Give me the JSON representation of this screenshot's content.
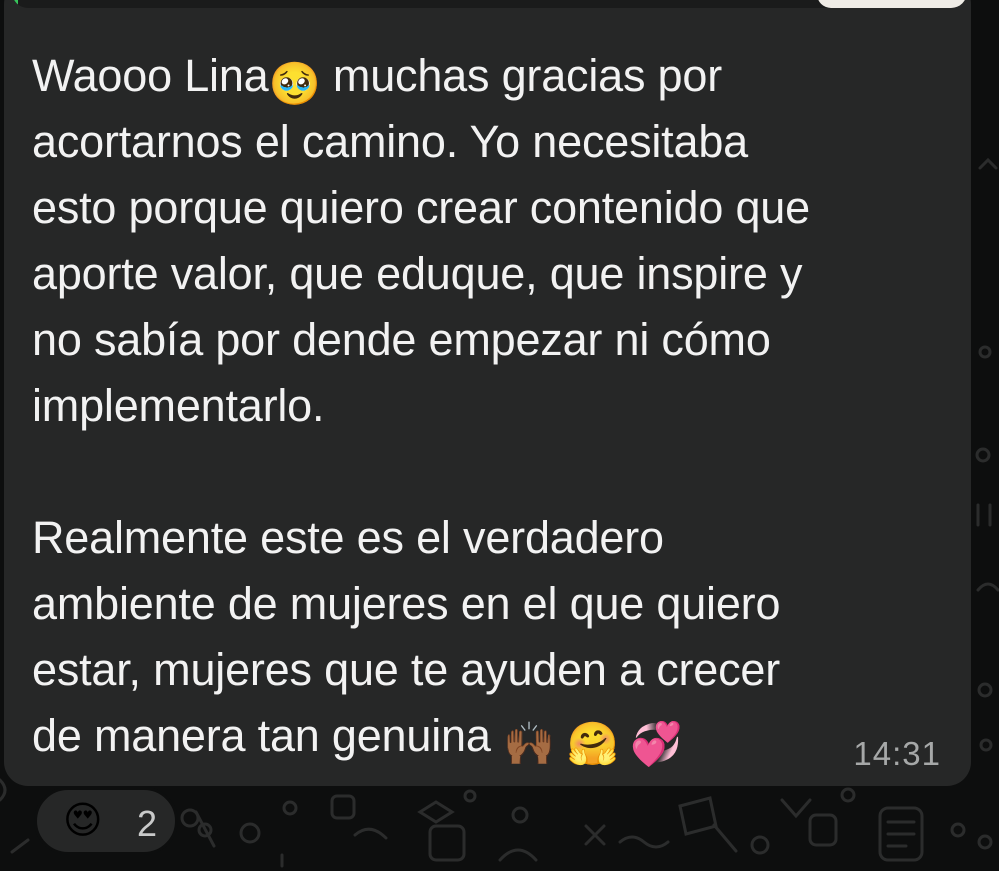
{
  "message": {
    "line1_before": "Waooo Lina",
    "line1_emoji": "🥹",
    "line1_after": " muchas gracias por",
    "body_lines": "acortarnos el camino. Yo necesitaba\nesto porque quiero crear contenido que\naporte valor, que eduque, que inspire y\nno sabía por dende empezar ni cómo\nimplementarlo.\n\nRealmente este es el verdadero\nambiente de mujeres en el que quiero\nestar, mujeres que te ayuden a crecer\nde manera tan genuina ",
    "end_emojis": "🙌🏾 🤗 💞",
    "timestamp": "14:31"
  },
  "reaction": {
    "emoji": "😍",
    "count": "2"
  },
  "colors": {
    "bubble": "#262727",
    "background": "#0d0e0e",
    "text": "#f2f2f2",
    "timestamp": "#a6a8a8",
    "quote_accent": "#37c35b"
  },
  "icons": {
    "background_pattern": "chat-doodle-pattern"
  }
}
